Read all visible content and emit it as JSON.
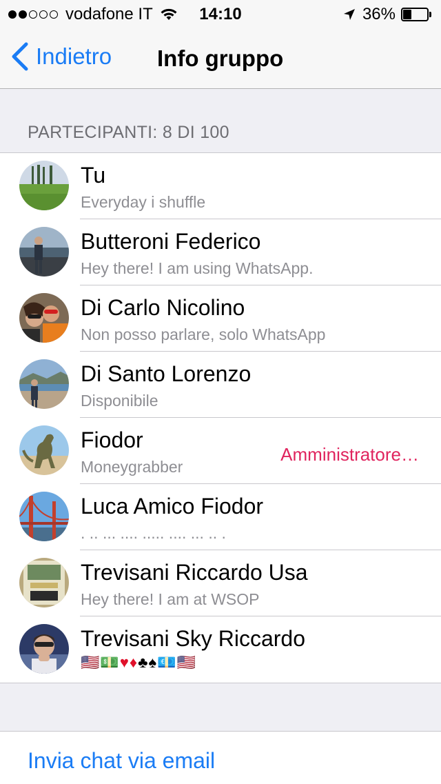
{
  "status_bar": {
    "carrier": "vodafone IT",
    "signal_bars_filled": 2,
    "signal_bars_total": 5,
    "time": "14:10",
    "battery_percent": "36%",
    "battery_level": 0.36,
    "icons": [
      "wifi-icon",
      "location-arrow-icon",
      "battery-icon"
    ]
  },
  "nav": {
    "back_label": "Indietro",
    "back_icon": "chevron-left-icon",
    "title": "Info gruppo",
    "accent_color": "#1a7cf5"
  },
  "section": {
    "header": "PARTECIPANTI: 8 DI 100"
  },
  "participants": [
    {
      "name": "Tu",
      "status": "Everyday i shuffle"
    },
    {
      "name": "Butteroni Federico",
      "status": "Hey there! I am using WhatsApp."
    },
    {
      "name": "Di Carlo Nicolino",
      "status": "Non posso parlare, solo WhatsApp"
    },
    {
      "name": "Di Santo Lorenzo",
      "status": "Disponibile"
    },
    {
      "name": "Fiodor",
      "status": "Moneygrabber",
      "badge": "Amministratore…",
      "badge_color": "#e0245e"
    },
    {
      "name": "Luca Amico Fiodor",
      "status": ". .. ... .... ..... .... ... .. ."
    },
    {
      "name": "Trevisani Riccardo Usa",
      "status": "Hey there! I am at WSOP"
    },
    {
      "name": "Trevisani Sky Riccardo",
      "status_emoji": [
        "us-flag",
        "dollar-banknote",
        "red-heart",
        "diamond-suit",
        "club-suit",
        "spade-suit",
        "euro-banknote",
        "us-flag"
      ]
    }
  ],
  "actions": {
    "email_chat": "Invia chat via email"
  }
}
